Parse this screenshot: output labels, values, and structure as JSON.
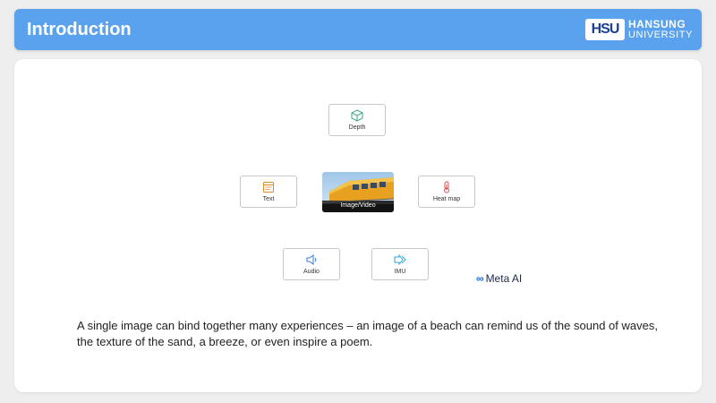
{
  "header": {
    "title": "Introduction",
    "logo_mark": "HSU",
    "logo_line1": "HANSUNG",
    "logo_line2": "UNIVERSITY"
  },
  "modalities": {
    "depth": "Depth",
    "text": "Text",
    "image_video": "Image/Video",
    "heat_map": "Heat map",
    "audio": "Audio",
    "imu": "IMU"
  },
  "brand": {
    "symbol": "∞",
    "name": "Meta AI"
  },
  "caption": "A single image can bind together many experiences – an image of a beach can remind us of the sound of waves, the texture of the sand, a breeze, or even inspire a poem.",
  "colors": {
    "header_bg": "#5aa2ee",
    "depth_icon": "#3aa57a",
    "text_icon": "#e08a2a",
    "heat_icon": "#d9534f",
    "audio_icon": "#3a7bd5",
    "imu_icon": "#29a8d8",
    "meta_blue": "#0866ff"
  }
}
